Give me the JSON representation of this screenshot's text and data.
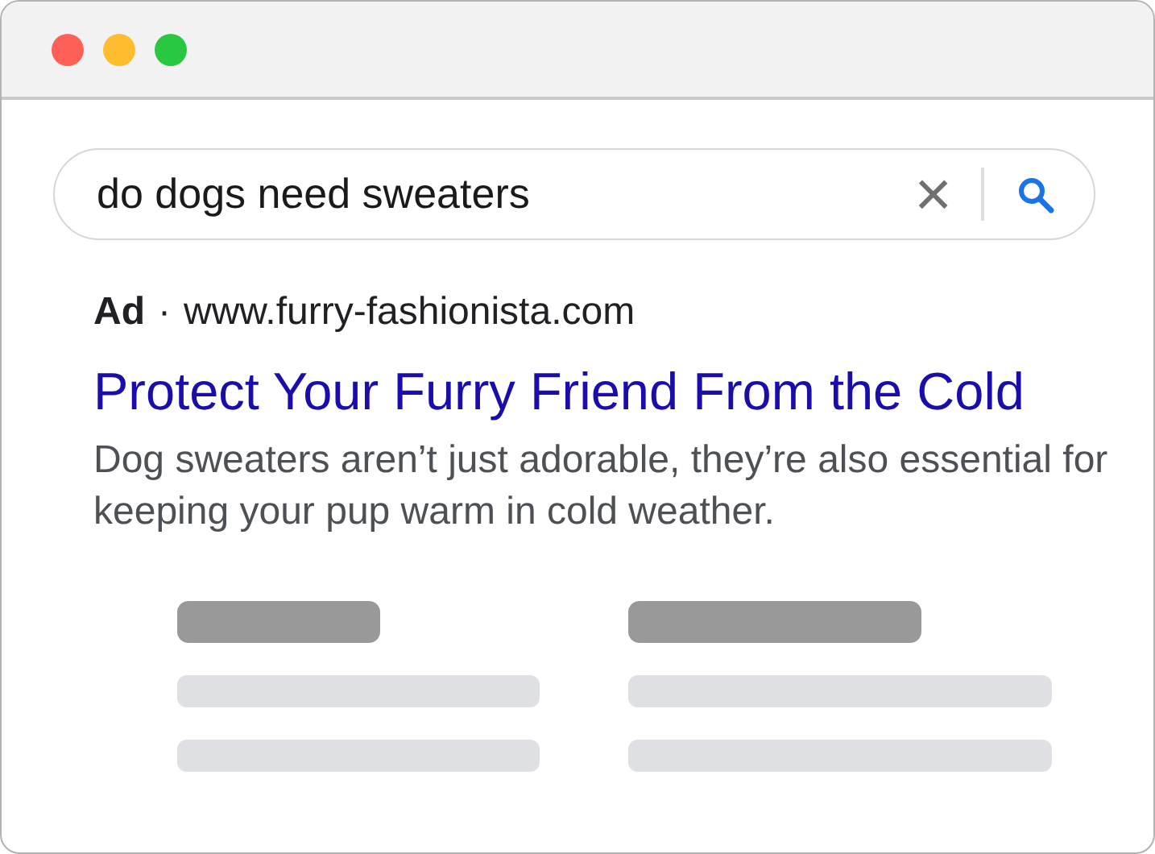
{
  "window": {
    "controls": [
      {
        "color": "#fe5f57"
      },
      {
        "color": "#febc2e"
      },
      {
        "color": "#28c840"
      }
    ]
  },
  "search": {
    "value": "do dogs need sweaters",
    "clear": "×"
  },
  "ad": {
    "label": "Ad",
    "separator": "·",
    "url": "www.furry-fashionista.com",
    "title": "Protect Your Furry Friend From the Cold",
    "description": "Dog sweaters aren’t just adorable, they’re also essential for keeping your pup warm in cold weather."
  },
  "result_placeholders": [
    {
      "kind": "skeleton"
    },
    {
      "kind": "skeleton"
    }
  ]
}
